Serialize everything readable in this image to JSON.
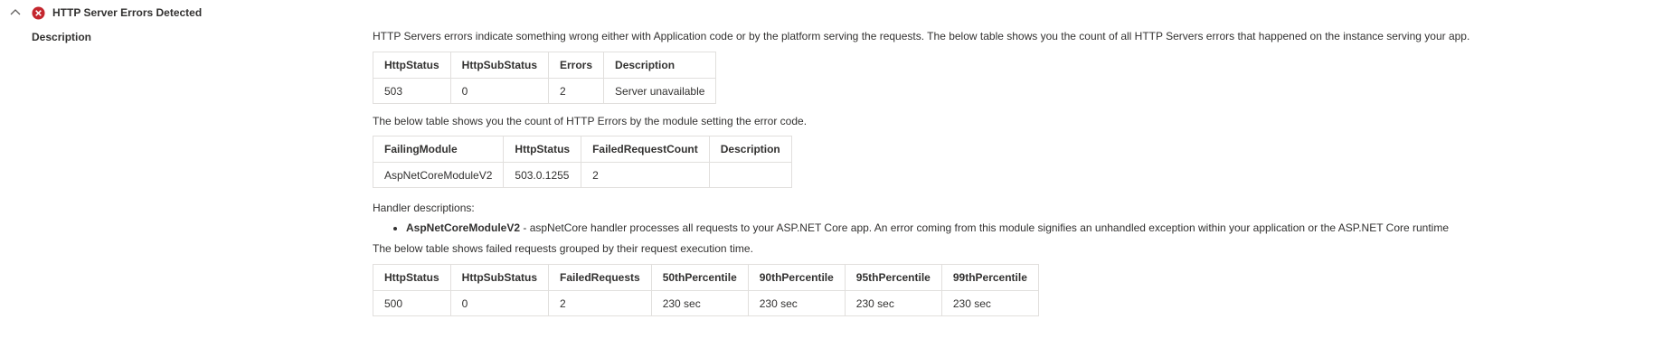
{
  "header": {
    "title": "HTTP Server Errors Detected",
    "chevron_icon": "chevron-up-icon",
    "status_icon": "error-circle-icon",
    "status_color": "#c4262e"
  },
  "description_label": "Description",
  "intro_text": "HTTP Servers errors indicate something wrong either with Application code or by the platform serving the requests. The below table shows you the count of all HTTP Servers errors that happened on the instance serving your app.",
  "table1": {
    "headers": [
      "HttpStatus",
      "HttpSubStatus",
      "Errors",
      "Description"
    ],
    "rows": [
      [
        "503",
        "0",
        "2",
        "Server unavailable"
      ]
    ]
  },
  "module_text": "The below table shows you the count of HTTP Errors by the module setting the error code.",
  "table2": {
    "headers": [
      "FailingModule",
      "HttpStatus",
      "FailedRequestCount",
      "Description"
    ],
    "rows": [
      [
        "AspNetCoreModuleV2",
        "503.0.1255",
        "2",
        ""
      ]
    ]
  },
  "handler_label": "Handler descriptions:",
  "handlers": [
    {
      "name": "AspNetCoreModuleV2",
      "description": " - aspNetCore handler processes all requests to your ASP.NET Core app. An error coming from this module signifies an unhandled exception within your application or the ASP.NET Core runtime"
    }
  ],
  "timing_text": "The below table shows failed requests grouped by their request execution time.",
  "table3": {
    "headers": [
      "HttpStatus",
      "HttpSubStatus",
      "FailedRequests",
      "50thPercentile",
      "90thPercentile",
      "95thPercentile",
      "99thPercentile"
    ],
    "rows": [
      [
        "500",
        "0",
        "2",
        "230 sec",
        "230 sec",
        "230 sec",
        "230 sec"
      ]
    ]
  }
}
